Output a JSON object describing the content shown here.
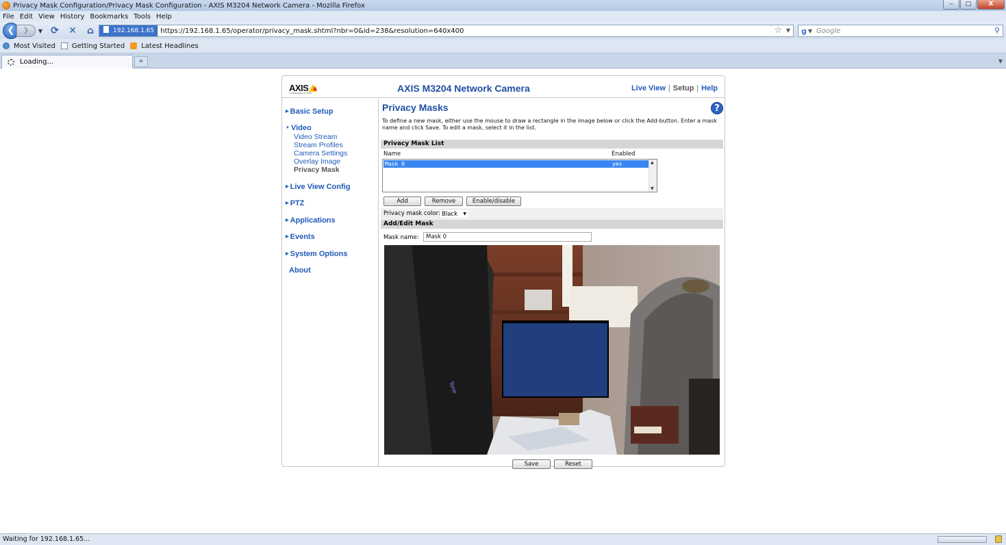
{
  "window": {
    "title": "Privacy Mask Configuration/Privacy Mask Configuration - AXIS M3204 Network Camera - Mozilla Firefox",
    "controls": [
      "‒",
      "□",
      "X"
    ]
  },
  "menu": [
    "File",
    "Edit",
    "View",
    "History",
    "Bookmarks",
    "Tools",
    "Help"
  ],
  "nav": {
    "site_badge": "192.168.1.65",
    "url": "https://192.168.1.65/operator/privacy_mask.shtml?nbr=0&id=238&resolution=640x400",
    "search_placeholder": "Google"
  },
  "bookmarks": [
    "Most Visited",
    "Getting Started",
    "Latest Headlines"
  ],
  "tab": {
    "label": "Loading...",
    "new_tab": "+"
  },
  "camera": {
    "logo": "AXIS",
    "logo_sub": "COMMUNICATIONS",
    "title": "AXIS M3204 Network Camera",
    "links": {
      "live_view": "Live View",
      "setup": "Setup",
      "help": "Help",
      "sep": "|"
    }
  },
  "sidebar": {
    "basic_setup": "Basic Setup",
    "video": "Video",
    "video_sub": [
      "Video Stream",
      "Stream Profiles",
      "Camera Settings",
      "Overlay Image",
      "Privacy Mask"
    ],
    "live_view_config": "Live View Config",
    "ptz": "PTZ",
    "applications": "Applications",
    "events": "Events",
    "system_options": "System Options",
    "about": "About"
  },
  "main": {
    "title": "Privacy Masks",
    "help": "?",
    "description": "To define a new mask, either use the mouse to draw a rectangle in the image below or click the Add-button. Enter a mask name and click Save. To edit a mask, select it in the list.",
    "list_header": "Privacy Mask List",
    "col_name": "Name",
    "col_enabled": "Enabled",
    "rows": [
      {
        "name": "Mask 0",
        "enabled": "yes"
      }
    ],
    "buttons": {
      "add": "Add",
      "remove": "Remove",
      "enable_disable": "Enable/disable"
    },
    "color_label": "Privacy mask color:",
    "color_value": "Black",
    "edit_header": "Add/Edit Mask",
    "mask_name_label": "Mask name:",
    "mask_name_value": "Mask 0",
    "save": "Save",
    "reset": "Reset",
    "mask_color": "#213f7e"
  },
  "status": {
    "text": "Waiting for 192.168.1.65..."
  }
}
